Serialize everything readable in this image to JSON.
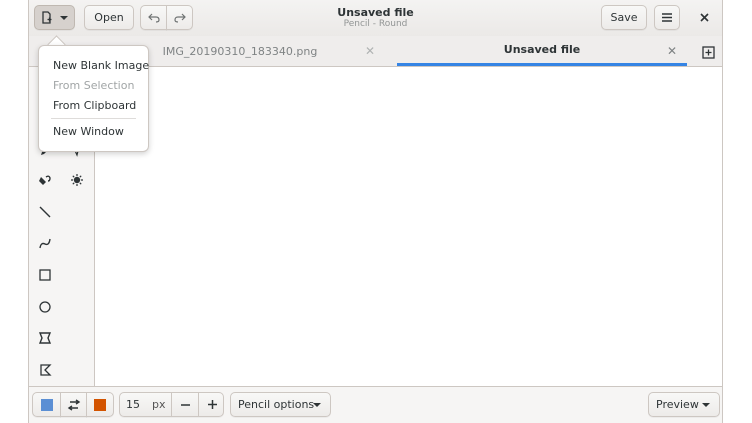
{
  "header": {
    "open_label": "Open",
    "save_label": "Save",
    "title": "Unsaved file",
    "subtitle": "Pencil - Round"
  },
  "tabs": [
    {
      "label": "IMG_20190310_183340.png",
      "active": false
    },
    {
      "label": "Unsaved file",
      "active": true
    }
  ],
  "new_menu": {
    "items": [
      {
        "label": "New Blank Image",
        "enabled": true
      },
      {
        "label": "From Selection",
        "enabled": false
      },
      {
        "label": "From Clipboard",
        "enabled": true
      },
      {
        "label": "New Window",
        "enabled": true
      }
    ]
  },
  "tools": [
    "pencil-icon",
    "select-icon",
    "paint-icon",
    "filter-icon",
    "line-icon",
    "curve-icon",
    "rectangle-icon",
    "circle-icon",
    "polygon-icon",
    "freeshape-icon"
  ],
  "bottom": {
    "size_value": "15",
    "size_unit": "px",
    "options_label": "Pencil options",
    "preview_label": "Preview",
    "main_color": "#5b8fd4",
    "secondary_color": "#d35400"
  },
  "colors": {
    "accent": "#3584e4",
    "headerbar": "#ebe9e7",
    "border": "#cdc7c2"
  }
}
